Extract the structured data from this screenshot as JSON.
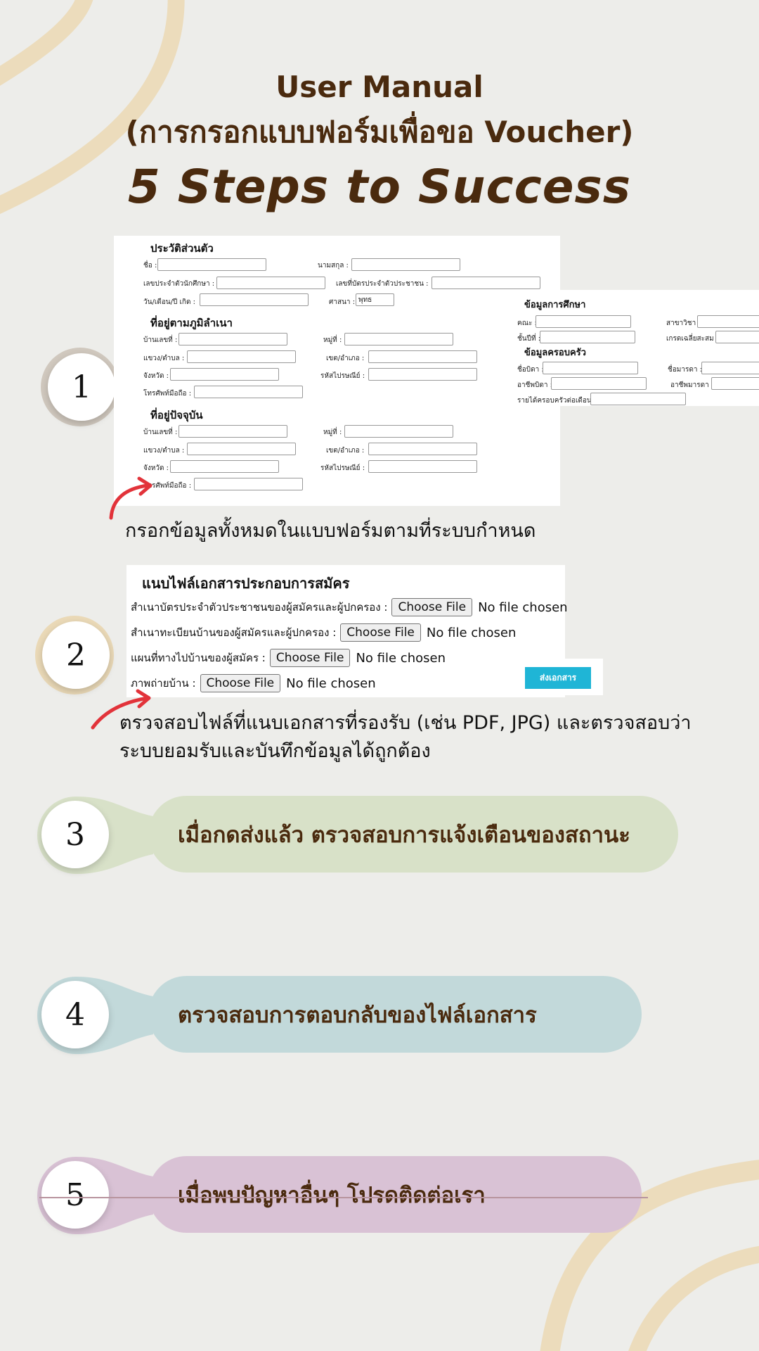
{
  "header": {
    "title_line1": "User Manual",
    "title_line2": "(การกรอกแบบฟอร์มเพื่อขอ Voucher)",
    "subtitle": "5 Steps to Success"
  },
  "steps": [
    {
      "number": "1",
      "text": "กรอกข้อมูลทั้งหมดในแบบฟอร์มตามที่ระบบกำหนด",
      "color": "#cfc7bd"
    },
    {
      "number": "2",
      "text_line1": "ตรวจสอบไฟล์ที่แนบเอกสารที่รองรับ (เช่น PDF, JPG) และตรวจสอบว่า",
      "text_line2": "ระบบยอมรับและบันทึกข้อมูลได้ถูกต้อง",
      "color": "#ead9b7"
    },
    {
      "number": "3",
      "text": "เมื่อกดส่งแล้ว ตรวจสอบการแจ้งเตือนของสถานะ",
      "color": "#d8e1c8"
    },
    {
      "number": "4",
      "text": "ตรวจสอบการตอบกลับของไฟล์เอกสาร",
      "color": "#c2d9da"
    },
    {
      "number": "5",
      "text": "เมื่อพบปัญหาอื่นๆ โปรดติดต่อเรา",
      "color": "#d9c2d5"
    }
  ],
  "form": {
    "personal": {
      "heading": "ประวัติส่วนตัว",
      "name": "ชื่อ :",
      "surname": "นามสกุล :",
      "student_id": "เลขประจำตัวนักศึกษา :",
      "citizen_id": "เลขที่บัตรประจำตัวประชาชน :",
      "dob": "วัน/เดือน/ปี เกิด :",
      "religion": "ศาสนา :",
      "religion_value": "พุทธ"
    },
    "domicile": {
      "heading": "ที่อยู่ตามภูมิลำเนา",
      "house_no": "บ้านเลขที่ :",
      "moo": "หมู่ที่ :",
      "subdistrict": "แขวง/ตำบล :",
      "district": "เขต/อำเภอ :",
      "province": "จังหวัด :",
      "postcode": "รหัสไปรษณีย์ :",
      "mobile": "โทรศัพท์มือถือ :"
    },
    "current": {
      "heading": "ที่อยู่ปัจจุบัน",
      "house_no": "บ้านเลขที่ :",
      "moo": "หมู่ที่ :",
      "subdistrict": "แขวง/ตำบล :",
      "district": "เขต/อำเภอ :",
      "province": "จังหวัด :",
      "postcode": "รหัสไปรษณีย์ :",
      "mobile": "โทรศัพท์มือถือ :"
    },
    "education": {
      "heading": "ข้อมูลการศึกษา",
      "faculty": "คณะ :",
      "major": "สาขาวิชา :",
      "year": "ชั้นปีที่ :",
      "gpa": "เกรดเฉลี่ยสะสม :"
    },
    "family": {
      "heading": "ข้อมูลครอบครัว",
      "father": "ชื่อบิดา :",
      "mother": "ชื่อมารดา :",
      "father_job": "อาชีพบิดา :",
      "mother_job": "อาชีพมารดา :",
      "income": "รายได้ครอบครัวต่อเดือน :"
    }
  },
  "attachments": {
    "heading": "แนบไฟล์เอกสารประกอบการสมัคร",
    "rows": [
      {
        "label": "สำเนาบัตรประจำตัวประชาชนของผู้สมัครและผู้ปกครอง :",
        "button": "Choose File",
        "status": "No file chosen"
      },
      {
        "label": "สำเนาทะเบียนบ้านของผู้สมัครและผู้ปกครอง :",
        "button": "Choose File",
        "status": "No file chosen"
      },
      {
        "label": "แผนที่ทางไปบ้านของผู้สมัคร :",
        "button": "Choose File",
        "status": "No file chosen"
      },
      {
        "label": "ภาพถ่ายบ้าน :",
        "button": "Choose File",
        "status": "No file chosen"
      }
    ],
    "submit": "ส่งเอกสาร"
  },
  "colors": {
    "title": "#4a2a0e",
    "background": "#ededea",
    "arrow": "#e2333a",
    "submit": "#1fb5d6"
  }
}
